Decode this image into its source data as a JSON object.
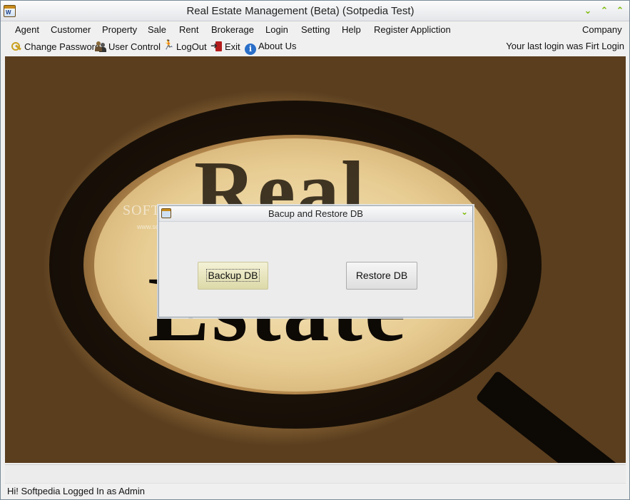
{
  "window": {
    "title": "Real Estate Management (Beta) (Sotpedia Test)",
    "icon_label": "W"
  },
  "controls": {
    "collapse": "⌄",
    "up": "⌃",
    "expand": "⌃"
  },
  "menu": [
    {
      "label": "Agent"
    },
    {
      "label": "Customer"
    },
    {
      "label": "Property"
    },
    {
      "label": "Sale"
    },
    {
      "label": "Rent"
    },
    {
      "label": "Brokerage"
    },
    {
      "label": "Login"
    },
    {
      "label": "Setting"
    },
    {
      "label": "Help"
    },
    {
      "label": "Register Appliction"
    }
  ],
  "menu_right": "Company",
  "toolbar": {
    "change_password": "Change Password",
    "user_control": "User Control",
    "logout": "LogOut",
    "exit": "Exit",
    "about": "About Us",
    "info_glyph": "i",
    "last_login": "Your last login was Firt Login"
  },
  "background": {
    "word1": "Real",
    "word2": "Estate",
    "watermark": "SOFTPEDIA",
    "watermark_sub": "www.softpedia.com"
  },
  "dialog": {
    "title": "Bacup and Restore DB",
    "ctrl": "⌄",
    "backup_label": "Backup DB",
    "restore_label": "Restore DB"
  },
  "status": {
    "text": "Hi! Softpedia  Logged In as Admin"
  }
}
